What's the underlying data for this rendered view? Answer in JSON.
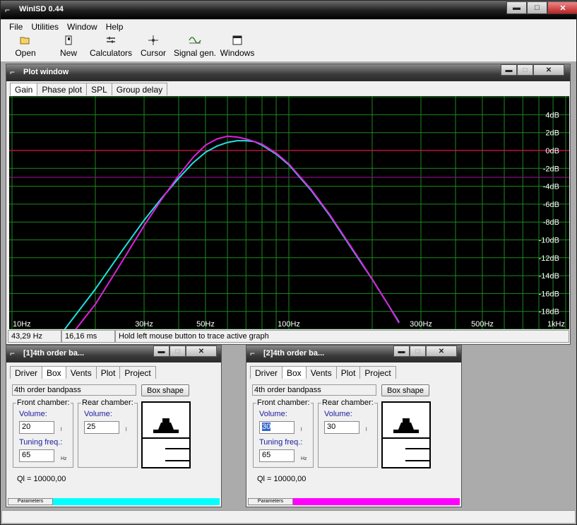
{
  "app": {
    "title": "WinISD 0.44"
  },
  "menu": [
    "File",
    "Utilities",
    "Window",
    "Help"
  ],
  "toolbar": [
    "Open",
    "New",
    "Calculators",
    "Cursor",
    "Signal gen.",
    "Windows"
  ],
  "plot_window": {
    "title": "Plot window",
    "tabs": [
      "Gain",
      "Phase plot",
      "SPL",
      "Group delay"
    ],
    "active_tab": "Gain",
    "status": {
      "frequency": "43,29 Hz",
      "time": "16,16 ms",
      "hint": "Hold left mouse button to trace active graph"
    }
  },
  "chart_data": {
    "type": "line",
    "x_scale": "log",
    "xlim": [
      10,
      1000
    ],
    "ylim": [
      -20,
      6
    ],
    "x_ticks": [
      {
        "value": 10,
        "label": "10Hz"
      },
      {
        "value": 30,
        "label": "30Hz"
      },
      {
        "value": 50,
        "label": "50Hz"
      },
      {
        "value": 100,
        "label": "100Hz"
      },
      {
        "value": 300,
        "label": "300Hz"
      },
      {
        "value": 500,
        "label": "500Hz"
      },
      {
        "value": 1000,
        "label": "1kHz"
      }
    ],
    "y_ticks": [
      {
        "value": 4,
        "label": "4dB"
      },
      {
        "value": 2,
        "label": "2dB"
      },
      {
        "value": 0,
        "label": "0dB"
      },
      {
        "value": -2,
        "label": "-2dB"
      },
      {
        "value": -4,
        "label": "-4dB"
      },
      {
        "value": -6,
        "label": "-6dB"
      },
      {
        "value": -8,
        "label": "-8dB"
      },
      {
        "value": -10,
        "label": "-10dB"
      },
      {
        "value": -12,
        "label": "-12dB"
      },
      {
        "value": -14,
        "label": "-14dB"
      },
      {
        "value": -16,
        "label": "-16dB"
      },
      {
        "value": -18,
        "label": "-18dB"
      }
    ],
    "grid": true,
    "series": [
      {
        "color": "#22e0e0",
        "x": [
          15.5,
          20,
          25,
          30,
          35,
          40,
          45,
          50,
          55,
          60,
          65,
          70,
          75,
          80,
          90,
          100,
          120,
          140,
          160,
          180,
          200,
          230,
          250
        ],
        "y": [
          -20,
          -15.5,
          -11.2,
          -7.8,
          -5.2,
          -3.1,
          -1.4,
          -0.2,
          0.5,
          0.9,
          1.1,
          1.1,
          1.0,
          0.6,
          -0.4,
          -1.6,
          -4.4,
          -7.2,
          -9.9,
          -12.3,
          -14.4,
          -17.4,
          -19.2
        ]
      },
      {
        "color": "#e020e0",
        "x": [
          17,
          20,
          25,
          30,
          35,
          40,
          45,
          50,
          55,
          60,
          65,
          70,
          75,
          80,
          90,
          100,
          120,
          140,
          160,
          180,
          200,
          230,
          250
        ],
        "y": [
          -20,
          -17.2,
          -12.4,
          -8.4,
          -5.3,
          -2.8,
          -0.8,
          0.6,
          1.3,
          1.6,
          1.5,
          1.3,
          1.0,
          0.7,
          -0.3,
          -1.5,
          -4.3,
          -7.1,
          -9.8,
          -12.2,
          -14.4,
          -17.4,
          -19.3
        ]
      }
    ],
    "reference_lines": [
      {
        "y": 0,
        "color": "#c01040"
      },
      {
        "y": -3,
        "color": "#7a1070"
      }
    ]
  },
  "box_windows": [
    {
      "title": "[1]4th order ba...",
      "tabs": [
        "Driver",
        "Box",
        "Vents",
        "Plot",
        "Project"
      ],
      "active_tab": "Box",
      "type": "4th order bandpass",
      "box_shape_label": "Box shape",
      "front": {
        "label": "Front chamber:",
        "volume_label": "Volume:",
        "volume": "20",
        "volume_unit": "l",
        "tuning_label": "Tuning freq.:",
        "tuning": "65",
        "tuning_unit": "Hz"
      },
      "rear": {
        "label": "Rear chamber:",
        "volume_label": "Volume:",
        "volume": "25",
        "volume_unit": "l"
      },
      "ql": "Ql = 10000,00",
      "params_label": "Parameters",
      "color": "#00ffff"
    },
    {
      "title": "[2]4th order ba...",
      "tabs": [
        "Driver",
        "Box",
        "Vents",
        "Plot",
        "Project"
      ],
      "active_tab": "Box",
      "type": "4th order bandpass",
      "box_shape_label": "Box shape",
      "front": {
        "label": "Front chamber:",
        "volume_label": "Volume:",
        "volume": "30",
        "volume_unit": "l",
        "tuning_label": "Tuning freq.:",
        "tuning": "65",
        "tuning_unit": "Hz"
      },
      "rear": {
        "label": "Rear chamber:",
        "volume_label": "Volume:",
        "volume": "30",
        "volume_unit": "l"
      },
      "ql": "Ql = 10000,00",
      "params_label": "Parameters",
      "color": "#ff00ff"
    }
  ]
}
